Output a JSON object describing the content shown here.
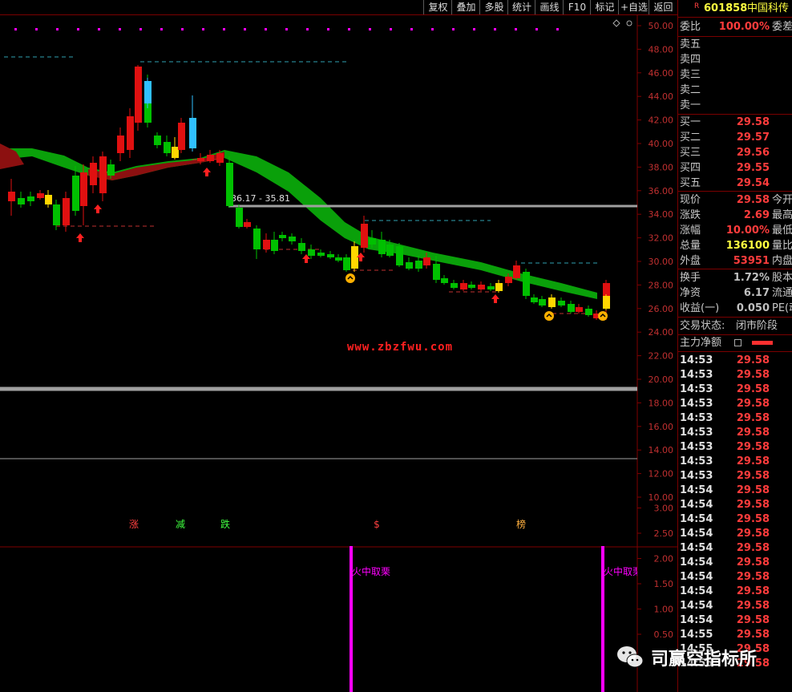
{
  "toolbar": {
    "buttons": [
      "复权",
      "叠加",
      "多股",
      "统计",
      "画线",
      "F10",
      "标记",
      "+自选",
      "返回"
    ]
  },
  "stock": {
    "badge": "R",
    "code": "601858",
    "name": "中国科传"
  },
  "order_ratio": {
    "label": "委比",
    "value": "100.00%",
    "extra": "委差"
  },
  "asks": [
    {
      "label": "卖五",
      "value": ""
    },
    {
      "label": "卖四",
      "value": ""
    },
    {
      "label": "卖三",
      "value": ""
    },
    {
      "label": "卖二",
      "value": ""
    },
    {
      "label": "卖一",
      "value": ""
    }
  ],
  "bids": [
    {
      "label": "买一",
      "value": "29.58"
    },
    {
      "label": "买二",
      "value": "29.57"
    },
    {
      "label": "买三",
      "value": "29.56"
    },
    {
      "label": "买四",
      "value": "29.55"
    },
    {
      "label": "买五",
      "value": "29.54"
    }
  ],
  "quote": [
    {
      "label": "现价",
      "value": "29.58",
      "color": "red",
      "extra": "今开"
    },
    {
      "label": "涨跌",
      "value": "2.69",
      "color": "red",
      "extra": "最高"
    },
    {
      "label": "涨幅",
      "value": "10.00%",
      "color": "red",
      "extra": "最低"
    },
    {
      "label": "总量",
      "value": "136100",
      "color": "yellow",
      "extra": "量比"
    },
    {
      "label": "外盘",
      "value": "53951",
      "color": "red",
      "extra": "内盘"
    }
  ],
  "stats": [
    {
      "label": "换手",
      "value": "1.72%",
      "extra": "股本"
    },
    {
      "label": "净资",
      "value": "6.17",
      "extra": "流通"
    },
    {
      "label": "收益(一)",
      "value": "0.050",
      "extra": "PE(动"
    }
  ],
  "trade_status": {
    "label": "交易状态:",
    "value": "闭市阶段"
  },
  "main_net": {
    "label": "主力净额"
  },
  "ticks": [
    {
      "time": "14:53",
      "price": "29.58"
    },
    {
      "time": "14:53",
      "price": "29.58"
    },
    {
      "time": "14:53",
      "price": "29.58"
    },
    {
      "time": "14:53",
      "price": "29.58"
    },
    {
      "time": "14:53",
      "price": "29.58"
    },
    {
      "time": "14:53",
      "price": "29.58"
    },
    {
      "time": "14:53",
      "price": "29.58"
    },
    {
      "time": "14:53",
      "price": "29.58"
    },
    {
      "time": "14:53",
      "price": "29.58"
    },
    {
      "time": "14:54",
      "price": "29.58"
    },
    {
      "time": "14:54",
      "price": "29.58"
    },
    {
      "time": "14:54",
      "price": "29.58"
    },
    {
      "time": "14:54",
      "price": "29.58"
    },
    {
      "time": "14:54",
      "price": "29.58"
    },
    {
      "time": "14:54",
      "price": "29.58"
    },
    {
      "time": "14:54",
      "price": "29.58"
    },
    {
      "time": "14:54",
      "price": "29.58"
    },
    {
      "time": "14:54",
      "price": "29.58"
    },
    {
      "time": "14:54",
      "price": "29.58"
    },
    {
      "time": "14:55",
      "price": "29.58"
    },
    {
      "time": "14:55",
      "price": "29.58"
    },
    {
      "time": "14:55",
      "price": "29.58"
    }
  ],
  "chart": {
    "price_axis": [
      "50.00",
      "48.00",
      "46.00",
      "44.00",
      "42.00",
      "40.00",
      "38.00",
      "36.00",
      "34.00",
      "32.00",
      "30.00",
      "28.00",
      "26.00",
      "24.00",
      "22.00",
      "20.00",
      "18.00",
      "16.00",
      "14.00",
      "12.00",
      "10.00"
    ],
    "indicator_axis": [
      "3.00",
      "2.50",
      "2.00",
      "1.50",
      "1.00",
      "0.50"
    ],
    "range_label": "36.17 - 35.81",
    "url_text": "www.zbzfwu.com",
    "markers": [
      {
        "text": "涨",
        "color": "#ff4040"
      },
      {
        "text": "减",
        "color": "#40ff40"
      },
      {
        "text": "跌",
        "color": "#40ff40"
      },
      {
        "text": "$",
        "color": "#ff4040"
      },
      {
        "text": "榜",
        "color": "#ffb040"
      }
    ],
    "signal_label_1": "火中取栗",
    "signal_label_2": "火中取栗",
    "colors": {
      "up": "#e01010",
      "down": "#00c000",
      "band_up": "#0aa00a",
      "band_down": "#8c1010",
      "axis": "#800000",
      "signal": "#ff00ff",
      "yellow": "#ffd700",
      "cyan": "#30c0ff"
    }
  },
  "watermark": {
    "text": "司赢空指标所"
  }
}
